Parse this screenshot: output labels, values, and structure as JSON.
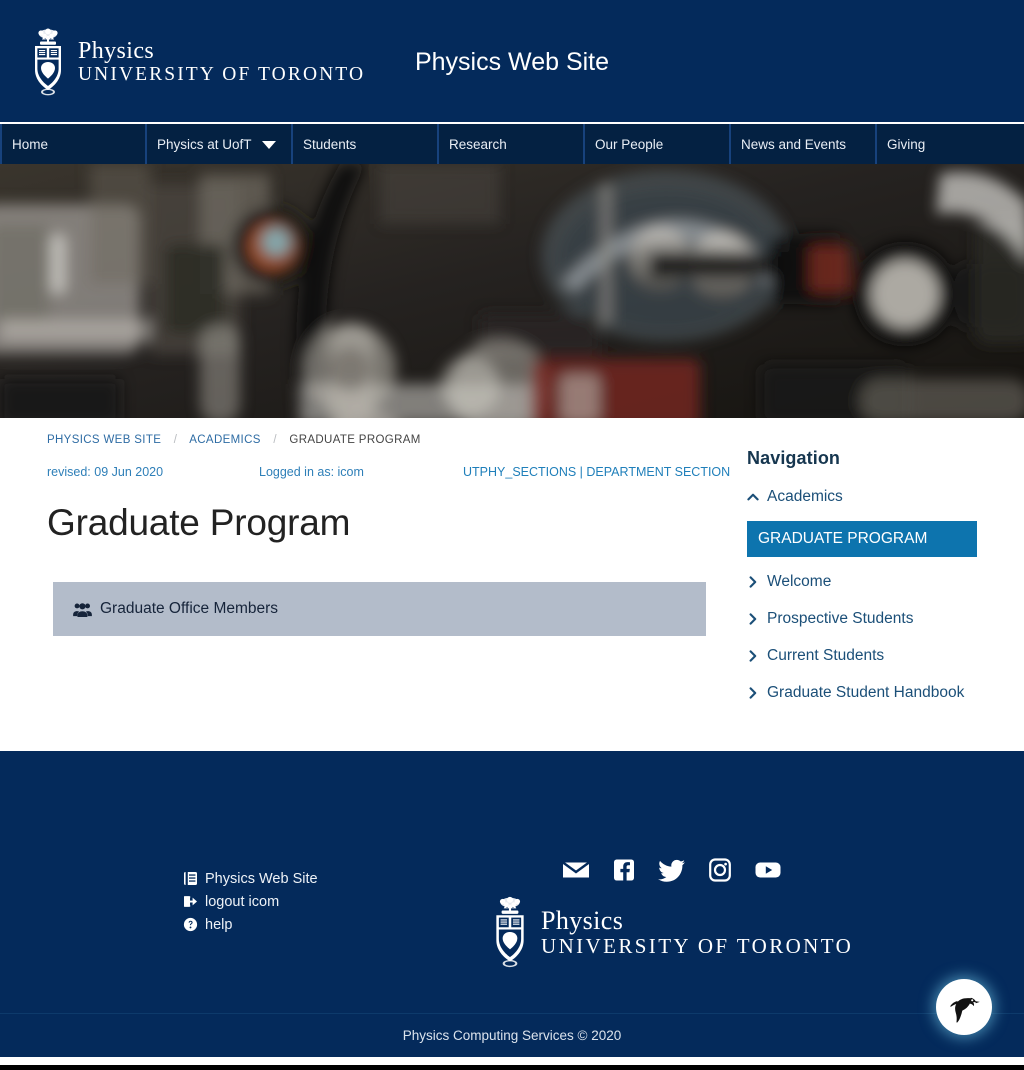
{
  "header": {
    "site_title": "Physics Web Site",
    "logo": {
      "line1": "Physics",
      "line2": "UNIVERSITY OF TORONTO"
    },
    "background_color": "#042a5b"
  },
  "nav": {
    "items": [
      {
        "label": "Home",
        "has_dropdown": false
      },
      {
        "label": "Physics at UofT",
        "has_dropdown": true
      },
      {
        "label": "Students",
        "has_dropdown": false
      },
      {
        "label": "Research",
        "has_dropdown": false
      },
      {
        "label": "Our People",
        "has_dropdown": false
      },
      {
        "label": "News and Events",
        "has_dropdown": false
      },
      {
        "label": "Giving",
        "has_dropdown": false
      }
    ]
  },
  "hero": {
    "alt": "blurred optics laboratory bench with mirror mounts"
  },
  "breadcrumb": {
    "items": [
      {
        "label": "PHYSICS WEB SITE"
      },
      {
        "label": "ACADEMICS"
      },
      {
        "label": "GRADUATE PROGRAM"
      }
    ],
    "separator": "/"
  },
  "meta": {
    "revised": "revised: 09 Jun 2020",
    "logged_in": "Logged in as: icom",
    "sections": "UTPHY_SECTIONS | DEPARTMENT SECTION"
  },
  "main": {
    "page_title": "Graduate Program",
    "panel": {
      "label": "Graduate Office Members",
      "icon": "users-icon",
      "background_color": "#b3bcca"
    }
  },
  "sidebar": {
    "title": "Navigation",
    "items": [
      {
        "label": "Academics",
        "icon": "chevron-up-icon",
        "active": false
      },
      {
        "label": "GRADUATE PROGRAM",
        "icon": "",
        "active": true
      },
      {
        "label": "Welcome",
        "icon": "chevron-right-icon",
        "active": false
      },
      {
        "label": "Prospective Students",
        "icon": "chevron-right-icon",
        "active": false
      },
      {
        "label": "Current Students",
        "icon": "chevron-right-icon",
        "active": false
      },
      {
        "label": "Graduate Student Handbook",
        "icon": "chevron-right-icon",
        "active": false
      }
    ],
    "active_color": "#0d74ae"
  },
  "footer": {
    "links": [
      {
        "label": "Physics Web Site",
        "icon": "book-icon"
      },
      {
        "label": "logout icom",
        "icon": "logout-icon"
      },
      {
        "label": "help",
        "icon": "question-circle-icon"
      }
    ],
    "social": [
      {
        "name": "envelope-icon"
      },
      {
        "name": "facebook-icon"
      },
      {
        "name": "twitter-icon"
      },
      {
        "name": "instagram-icon"
      },
      {
        "name": "youtube-icon"
      }
    ],
    "logo": {
      "line1": "Physics",
      "line2": "UNIVERSITY OF TORONTO"
    },
    "copyright": "Physics Computing Services © 2020"
  },
  "fab": {
    "name": "bird-icon"
  }
}
